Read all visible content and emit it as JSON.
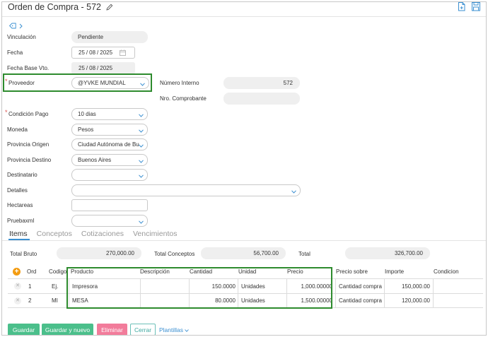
{
  "header": {
    "title": "Orden de Compra - 572"
  },
  "form": {
    "vinculacion": {
      "label": "Vinculación",
      "value": "Pendiente"
    },
    "fecha": {
      "label": "Fecha",
      "day": "25",
      "month": "08",
      "year": "2025"
    },
    "fecha_base": {
      "label": "Fecha Base Vto.",
      "day": "25",
      "month": "08",
      "year": "2025"
    },
    "proveedor": {
      "label": "Proveedor",
      "value": "@YVKE MUNDIAL"
    },
    "numero_interno": {
      "label": "Número Interno",
      "value": "572"
    },
    "nro_comprobante": {
      "label": "Nro. Comprobante",
      "value": ""
    },
    "condicion_pago": {
      "label": "Condición Pago",
      "value": "10 dias"
    },
    "moneda": {
      "label": "Moneda",
      "value": "Pesos"
    },
    "provincia_origen": {
      "label": "Provincia Origen",
      "value": "Ciudad Autónoma de Bu"
    },
    "provincia_destino": {
      "label": "Provincia Destino",
      "value": "Buenos Aires"
    },
    "destinatario": {
      "label": "Destinatario",
      "value": ""
    },
    "detalles": {
      "label": "Detalles",
      "value": ""
    },
    "hectareas": {
      "label": "Hectareas",
      "value": ""
    },
    "pruebaxml": {
      "label": "Pruebaxml",
      "value": ""
    }
  },
  "tabs": [
    "Items",
    "Conceptos",
    "Cotizaciones",
    "Vencimientos"
  ],
  "totals": {
    "bruto_label": "Total Bruto",
    "bruto": "270,000.00",
    "conceptos_label": "Total Conceptos",
    "conceptos": "56,700.00",
    "total_label": "Total",
    "total": "326,700.00"
  },
  "table": {
    "headers": [
      "Ord",
      "Codigo",
      "Producto",
      "Descripción",
      "Cantidad",
      "Unidad",
      "Precio",
      "Precio sobre",
      "Importe",
      "Condicion"
    ],
    "rows": [
      {
        "ord": "1",
        "codigo": "Ej.",
        "producto": "Impresora",
        "descripcion": "",
        "cantidad": "150.0000",
        "unidad": "Unidades",
        "precio": "1,000.00000",
        "precio_sobre": "Cantidad compra",
        "importe": "150,000.00",
        "condicion": ""
      },
      {
        "ord": "2",
        "codigo": "MI",
        "producto": "MESA",
        "descripcion": "",
        "cantidad": "80.0000",
        "unidad": "Unidades",
        "precio": "1,500.00000",
        "precio_sobre": "Cantidad compra",
        "importe": "120,000.00",
        "condicion": ""
      }
    ]
  },
  "buttons": {
    "guardar": "Guardar",
    "guardar_nuevo": "Guardar y nuevo",
    "eliminar": "Eliminar",
    "cerrar": "Cerrar",
    "plantillas": "Plantillas"
  },
  "colors": {
    "accent": "#3a8fd1",
    "save": "#4bbf8b",
    "delete": "#f27c9b",
    "highlight": "#2e8b2e"
  }
}
